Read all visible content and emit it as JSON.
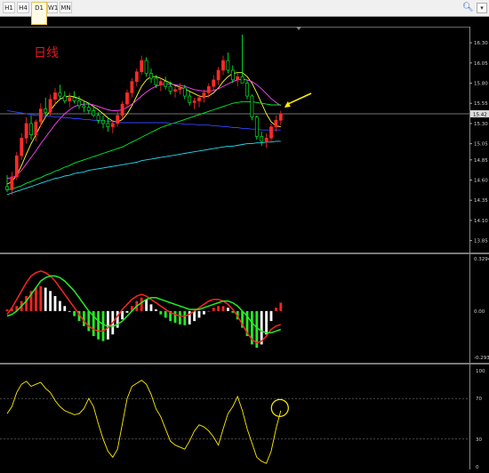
{
  "toolbar": {
    "timeframes": [
      "H1",
      "H4",
      "D1",
      "W1",
      "MN"
    ],
    "active": "D1",
    "search_icon": "search-icon",
    "dropdown_icon": "chevron-down-icon"
  },
  "chart_data": [
    {
      "type": "candlestick",
      "title": "日线",
      "title_color": "#e8141c",
      "background": "#000000",
      "ylim": [
        13.78,
        16.4
      ],
      "y_ticks": [
        "16.30",
        "16.05",
        "15.80",
        "15.55",
        "15.30",
        "15.05",
        "14.85",
        "14.60",
        "14.35",
        "14.10",
        "13.85"
      ],
      "current_price_label": "15.42",
      "current_price": 15.42,
      "up_color": "#ff2a2a",
      "down_color": "#00ff33",
      "candles": [
        [
          14.52,
          14.66,
          14.45,
          14.48
        ],
        [
          14.48,
          14.7,
          14.42,
          14.64
        ],
        [
          14.64,
          14.95,
          14.6,
          14.9
        ],
        [
          14.9,
          15.18,
          14.85,
          15.12
        ],
        [
          15.12,
          15.38,
          15.05,
          15.3
        ],
        [
          15.3,
          15.4,
          15.1,
          15.16
        ],
        [
          15.16,
          15.35,
          15.08,
          15.32
        ],
        [
          15.32,
          15.55,
          15.26,
          15.48
        ],
        [
          15.48,
          15.62,
          15.38,
          15.44
        ],
        [
          15.44,
          15.66,
          15.4,
          15.6
        ],
        [
          15.6,
          15.74,
          15.52,
          15.68
        ],
        [
          15.68,
          15.78,
          15.6,
          15.64
        ],
        [
          15.64,
          15.7,
          15.55,
          15.58
        ],
        [
          15.58,
          15.68,
          15.5,
          15.62
        ],
        [
          15.62,
          15.7,
          15.55,
          15.58
        ],
        [
          15.58,
          15.64,
          15.48,
          15.52
        ],
        [
          15.52,
          15.58,
          15.44,
          15.5
        ],
        [
          15.5,
          15.56,
          15.42,
          15.46
        ],
        [
          15.46,
          15.52,
          15.38,
          15.4
        ],
        [
          15.4,
          15.44,
          15.3,
          15.34
        ],
        [
          15.34,
          15.4,
          15.24,
          15.3
        ],
        [
          15.3,
          15.38,
          15.2,
          15.26
        ],
        [
          15.26,
          15.34,
          15.18,
          15.3
        ],
        [
          15.3,
          15.45,
          15.26,
          15.4
        ],
        [
          15.4,
          15.58,
          15.36,
          15.54
        ],
        [
          15.54,
          15.72,
          15.5,
          15.68
        ],
        [
          15.68,
          15.86,
          15.62,
          15.82
        ],
        [
          15.82,
          15.98,
          15.76,
          15.94
        ],
        [
          15.94,
          16.14,
          15.9,
          16.08
        ],
        [
          16.08,
          16.12,
          15.88,
          15.92
        ],
        [
          15.92,
          15.98,
          15.8,
          15.86
        ],
        [
          15.86,
          15.9,
          15.74,
          15.78
        ],
        [
          15.78,
          15.86,
          15.7,
          15.82
        ],
        [
          15.82,
          15.88,
          15.72,
          15.76
        ],
        [
          15.76,
          15.82,
          15.66,
          15.7
        ],
        [
          15.7,
          15.76,
          15.62,
          15.72
        ],
        [
          15.72,
          15.8,
          15.66,
          15.74
        ],
        [
          15.74,
          15.78,
          15.6,
          15.64
        ],
        [
          15.64,
          15.7,
          15.52,
          15.56
        ],
        [
          15.56,
          15.62,
          15.48,
          15.58
        ],
        [
          15.58,
          15.66,
          15.5,
          15.62
        ],
        [
          15.62,
          15.72,
          15.56,
          15.68
        ],
        [
          15.68,
          15.8,
          15.62,
          15.76
        ],
        [
          15.76,
          15.9,
          15.7,
          15.84
        ],
        [
          15.84,
          16.0,
          15.78,
          15.96
        ],
        [
          15.96,
          16.14,
          15.9,
          16.08
        ],
        [
          16.08,
          16.18,
          15.92,
          15.96
        ],
        [
          15.96,
          16.02,
          15.8,
          15.84
        ],
        [
          15.84,
          15.92,
          15.76,
          15.88
        ],
        [
          15.88,
          16.4,
          15.82,
          15.8
        ],
        [
          15.8,
          15.84,
          15.6,
          15.64
        ],
        [
          15.64,
          15.66,
          15.34,
          15.38
        ],
        [
          15.38,
          15.4,
          15.1,
          15.14
        ],
        [
          15.14,
          15.2,
          15.02,
          15.08
        ],
        [
          15.08,
          15.18,
          15.0,
          15.12
        ],
        [
          15.12,
          15.3,
          15.06,
          15.26
        ],
        [
          15.26,
          15.4,
          15.2,
          15.34
        ],
        [
          15.34,
          15.46,
          15.28,
          15.42
        ]
      ],
      "moving_averages": [
        {
          "color": "#ffff33",
          "values": [
            14.55,
            14.58,
            14.66,
            14.78,
            14.92,
            15.05,
            15.16,
            15.28,
            15.38,
            15.46,
            15.54,
            15.6,
            15.63,
            15.64,
            15.63,
            15.61,
            15.58,
            15.55,
            15.51,
            15.47,
            15.42,
            15.37,
            15.33,
            15.32,
            15.35,
            15.42,
            15.52,
            15.64,
            15.76,
            15.84,
            15.88,
            15.88,
            15.86,
            15.83,
            15.8,
            15.77,
            15.75,
            15.73,
            15.7,
            15.67,
            15.64,
            15.63,
            15.64,
            15.68,
            15.74,
            15.82,
            15.88,
            15.92,
            15.93,
            15.93,
            15.88,
            15.8,
            15.68,
            15.55,
            15.42,
            15.32,
            15.27,
            15.26
          ]
        },
        {
          "color": "#ff44ff",
          "values": [
            14.62,
            14.63,
            14.66,
            14.72,
            14.8,
            14.88,
            14.96,
            15.05,
            15.13,
            15.21,
            15.29,
            15.36,
            15.42,
            15.47,
            15.51,
            15.53,
            15.54,
            15.54,
            15.53,
            15.51,
            15.49,
            15.47,
            15.46,
            15.46,
            15.47,
            15.5,
            15.54,
            15.59,
            15.64,
            15.69,
            15.73,
            15.76,
            15.78,
            15.79,
            15.79,
            15.78,
            15.77,
            15.76,
            15.74,
            15.72,
            15.71,
            15.7,
            15.7,
            15.71,
            15.73,
            15.76,
            15.79,
            15.82,
            15.84,
            15.85,
            15.84,
            15.82,
            15.78,
            15.73,
            15.67,
            15.61,
            15.56,
            15.52
          ]
        },
        {
          "color": "#00ee33",
          "values": [
            14.48,
            14.49,
            14.51,
            14.53,
            14.56,
            14.58,
            14.61,
            14.63,
            14.66,
            14.68,
            14.71,
            14.73,
            14.76,
            14.78,
            14.81,
            14.83,
            14.85,
            14.87,
            14.89,
            14.91,
            14.93,
            14.95,
            14.97,
            14.99,
            15.01,
            15.04,
            15.07,
            15.1,
            15.13,
            15.16,
            15.19,
            15.22,
            15.25,
            15.27,
            15.29,
            15.31,
            15.33,
            15.35,
            15.37,
            15.39,
            15.41,
            15.43,
            15.45,
            15.47,
            15.49,
            15.51,
            15.53,
            15.55,
            15.56,
            15.57,
            15.57,
            15.57,
            15.56,
            15.55,
            15.54,
            15.53,
            15.53,
            15.53
          ]
        },
        {
          "color": "#3344ff",
          "values": [
            15.46,
            15.45,
            15.44,
            15.43,
            15.42,
            15.41,
            15.4,
            15.4,
            15.39,
            15.39,
            15.38,
            15.38,
            15.37,
            15.37,
            15.36,
            15.36,
            15.35,
            15.35,
            15.34,
            15.34,
            15.33,
            15.33,
            15.32,
            15.32,
            15.31,
            15.31,
            15.31,
            15.31,
            15.31,
            15.31,
            15.31,
            15.31,
            15.31,
            15.31,
            15.3,
            15.3,
            15.3,
            15.29,
            15.29,
            15.29,
            15.28,
            15.28,
            15.28,
            15.27,
            15.27,
            15.26,
            15.26,
            15.25,
            15.25,
            15.24,
            15.24,
            15.23,
            15.23,
            15.22,
            15.22,
            15.22,
            15.22,
            15.22
          ]
        },
        {
          "color": "#22ddee",
          "values": [
            14.42,
            14.44,
            14.46,
            14.48,
            14.5,
            14.52,
            14.54,
            14.56,
            14.58,
            14.6,
            14.62,
            14.63,
            14.65,
            14.66,
            14.68,
            14.69,
            14.7,
            14.72,
            14.73,
            14.74,
            14.75,
            14.76,
            14.77,
            14.78,
            14.79,
            14.8,
            14.81,
            14.82,
            14.84,
            14.85,
            14.86,
            14.87,
            14.88,
            14.89,
            14.9,
            14.91,
            14.92,
            14.93,
            14.94,
            14.95,
            14.96,
            14.97,
            14.98,
            14.99,
            15.0,
            15.01,
            15.02,
            15.02,
            15.03,
            15.04,
            15.05,
            15.05,
            15.06,
            15.06,
            15.07,
            15.07,
            15.08,
            15.08
          ]
        }
      ],
      "annotation_arrow_color": "#ffee00"
    },
    {
      "type": "macd",
      "ylim": [
        -0.2937,
        0.3294
      ],
      "y_ticks": [
        "0.3294",
        "0.00",
        "-0.2937"
      ],
      "line_colors": [
        "#ff2222",
        "#22ee22"
      ],
      "histogram_colors": {
        "up_positive": "#ff2222",
        "down_positive": "#ffffff",
        "down_negative": "#22ee22",
        "up_negative": "#ffffff"
      },
      "histogram": [
        0.01,
        0.015,
        0.03,
        0.06,
        0.09,
        0.12,
        0.14,
        0.15,
        0.14,
        0.12,
        0.09,
        0.06,
        0.03,
        0.0,
        -0.03,
        -0.06,
        -0.09,
        -0.12,
        -0.15,
        -0.17,
        -0.18,
        -0.17,
        -0.14,
        -0.1,
        -0.05,
        -0.01,
        0.03,
        0.06,
        0.08,
        0.07,
        0.04,
        0.01,
        -0.02,
        -0.04,
        -0.06,
        -0.07,
        -0.08,
        -0.085,
        -0.08,
        -0.06,
        -0.04,
        -0.02,
        0.0,
        0.02,
        0.03,
        0.03,
        0.02,
        -0.01,
        -0.05,
        -0.1,
        -0.15,
        -0.2,
        -0.22,
        -0.2,
        -0.14,
        -0.06,
        0.02,
        0.05
      ],
      "red_line": [
        -0.02,
        0.02,
        0.07,
        0.12,
        0.17,
        0.21,
        0.23,
        0.24,
        0.23,
        0.21,
        0.18,
        0.14,
        0.1,
        0.06,
        0.02,
        -0.02,
        -0.06,
        -0.09,
        -0.11,
        -0.12,
        -0.12,
        -0.1,
        -0.07,
        -0.03,
        0.01,
        0.04,
        0.07,
        0.09,
        0.1,
        0.09,
        0.07,
        0.05,
        0.03,
        0.01,
        -0.01,
        -0.02,
        -0.03,
        -0.03,
        -0.02,
        0.0,
        0.02,
        0.04,
        0.06,
        0.07,
        0.07,
        0.06,
        0.04,
        0.01,
        -0.03,
        -0.08,
        -0.13,
        -0.17,
        -0.19,
        -0.18,
        -0.15,
        -0.11,
        -0.09,
        -0.08
      ],
      "green_line": [
        -0.03,
        -0.02,
        0.0,
        0.03,
        0.06,
        0.1,
        0.14,
        0.18,
        0.2,
        0.21,
        0.21,
        0.2,
        0.18,
        0.15,
        0.12,
        0.08,
        0.04,
        0.0,
        -0.03,
        -0.06,
        -0.08,
        -0.09,
        -0.09,
        -0.08,
        -0.06,
        -0.03,
        0.0,
        0.03,
        0.05,
        0.07,
        0.08,
        0.08,
        0.07,
        0.06,
        0.05,
        0.04,
        0.03,
        0.02,
        0.01,
        0.01,
        0.01,
        0.02,
        0.03,
        0.04,
        0.05,
        0.06,
        0.06,
        0.05,
        0.03,
        0.0,
        -0.03,
        -0.07,
        -0.1,
        -0.12,
        -0.13,
        -0.13,
        -0.12,
        -0.11
      ]
    },
    {
      "type": "line",
      "ylim": [
        0,
        100
      ],
      "y_ticks": [
        "100",
        "70",
        "30",
        "0"
      ],
      "levels": [
        70,
        30
      ],
      "line_color": "#ffee00",
      "values": [
        55,
        62,
        76,
        84,
        87,
        82,
        84,
        86,
        80,
        76,
        68,
        62,
        58,
        56,
        54,
        55,
        60,
        70,
        62,
        45,
        30,
        18,
        12,
        20,
        45,
        70,
        82,
        85,
        88,
        84,
        74,
        60,
        52,
        40,
        28,
        24,
        22,
        20,
        28,
        38,
        44,
        42,
        38,
        32,
        24,
        40,
        55,
        62,
        72,
        58,
        40,
        26,
        12,
        8,
        6,
        18,
        40,
        58
      ]
    }
  ]
}
